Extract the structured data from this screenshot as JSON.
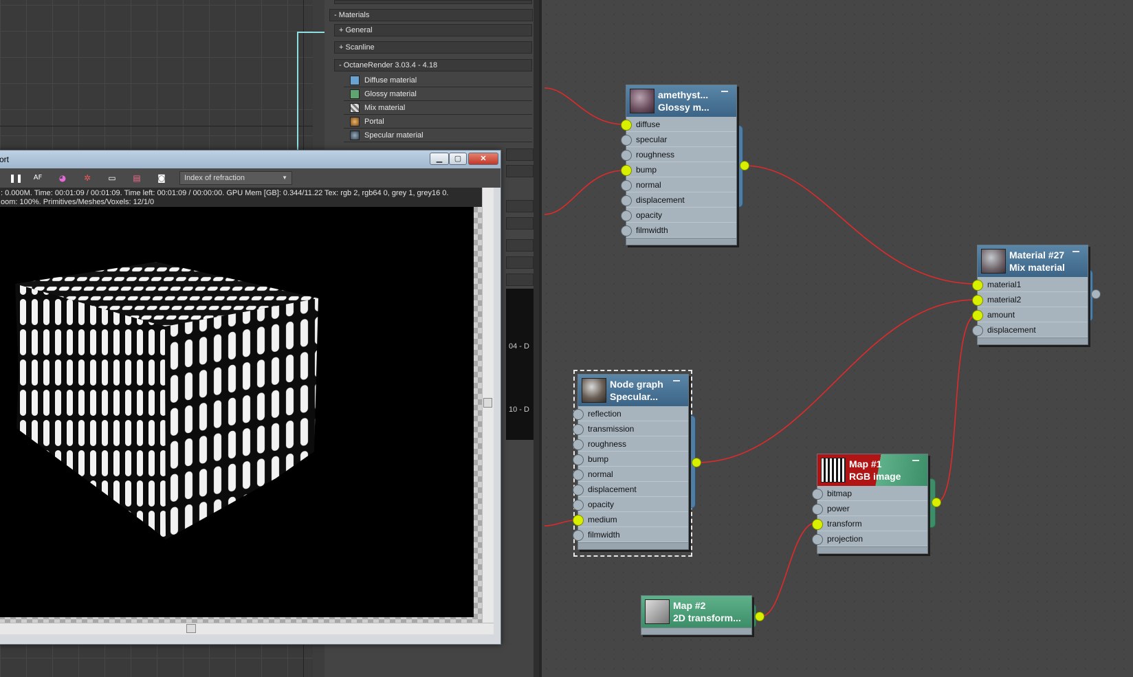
{
  "browser": {
    "sections": [
      {
        "label": "- Materials"
      },
      {
        "label": "+ General"
      },
      {
        "label": "+ Scanline"
      },
      {
        "label": "- OctaneRender 3.03.4 - 4.18"
      }
    ],
    "items": [
      {
        "label": "Diffuse material",
        "icon": "diffuse-material-icon"
      },
      {
        "label": "Glossy material",
        "icon": "glossy-material-icon"
      },
      {
        "label": "Mix material",
        "icon": "mix-material-icon"
      },
      {
        "label": "Portal",
        "icon": "portal-icon"
      },
      {
        "label": "Specular material",
        "icon": "specular-material-icon"
      }
    ],
    "hidden_labels": [
      "04 - D",
      "10 - D"
    ]
  },
  "render_window": {
    "title": "ort",
    "ior_dropdown": "Index of refraction",
    "status_line1": ": 0.000M.   Time: 00:01:09 / 00:01:09.   Time left: 00:01:09 / 00:00:00.   GPU Mem [GB]: 0.344/11.22   Tex: rgb 2, rgb64 0, grey 1, grey16 0.",
    "status_line2": "oom: 100%.   Primitives/Meshes/Voxels: 12/1/0",
    "toolbar_icons": [
      "pause-icon",
      "af-icon",
      "color-icon",
      "region-icon",
      "monitor-icon",
      "save-icon",
      "camera-icon"
    ]
  },
  "nodes": {
    "glossy": {
      "title1": "amethyst...",
      "title2": "Glossy m...",
      "slots": [
        "diffuse",
        "specular",
        "roughness",
        "bump",
        "normal",
        "displacement",
        "opacity",
        "filmwidth"
      ],
      "connected": [
        true,
        false,
        false,
        true,
        false,
        false,
        false,
        false
      ]
    },
    "mix": {
      "title1": "Material #27",
      "title2": "Mix material",
      "slots": [
        "material1",
        "material2",
        "amount",
        "displacement"
      ],
      "connected": [
        true,
        true,
        true,
        false
      ]
    },
    "specular": {
      "title1": "Node graph",
      "title2": "Specular...",
      "slots": [
        "reflection",
        "transmission",
        "roughness",
        "bump",
        "normal",
        "displacement",
        "opacity",
        "medium",
        "filmwidth"
      ],
      "connected": [
        false,
        false,
        false,
        false,
        false,
        false,
        false,
        true,
        false
      ]
    },
    "rgb": {
      "title1": "Map #1",
      "title2": "RGB image",
      "slots": [
        "bitmap",
        "power",
        "transform",
        "projection"
      ],
      "connected": [
        false,
        false,
        true,
        false
      ]
    },
    "transform": {
      "title1": "Map #2",
      "title2": "2D transform..."
    }
  },
  "colors": {
    "wire": "#e02a2a",
    "pin_active": "#d8f000",
    "node_blue": "#4a7598",
    "node_green": "#4ea07a"
  }
}
